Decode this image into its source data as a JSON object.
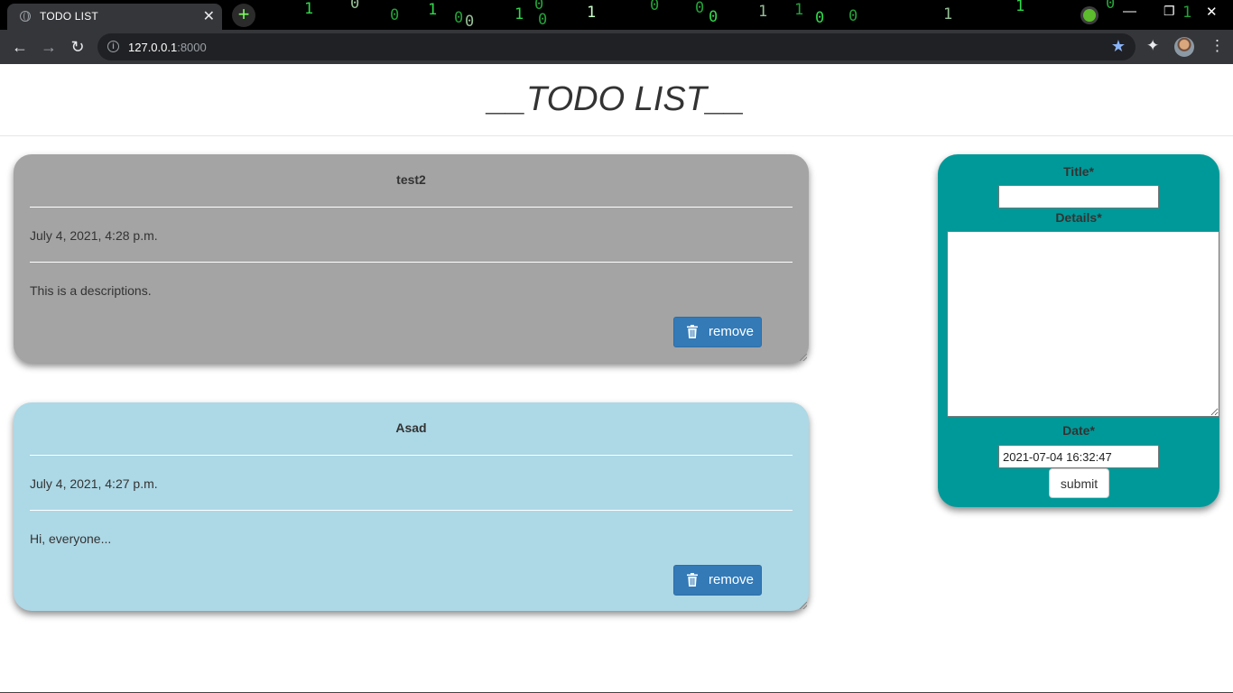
{
  "browser": {
    "tab_title": "TODO LIST",
    "tab_close": "✕",
    "new_tab": "+",
    "url_host": "127.0.0.1",
    "url_port": ":8000",
    "back": "←",
    "forward": "→",
    "reload": "↻",
    "star": "★",
    "extensions": "✦",
    "menu": "⋮",
    "minimize": "—",
    "maximize": "❐",
    "close": "✕",
    "matrix_glyphs": [
      "1",
      "0",
      "0",
      "1",
      "0",
      "0",
      "1",
      "0",
      "0",
      "1",
      "0",
      "0",
      "0",
      "1",
      "1",
      "0",
      "0",
      "1",
      "1",
      "0",
      "1"
    ]
  },
  "page": {
    "heading": "__TODO LIST__"
  },
  "todos": [
    {
      "title": "test2",
      "date": "July 4, 2021, 4:28 p.m.",
      "description": "This is a descriptions.",
      "remove_label": "remove",
      "bg_color": "#a4a4a4"
    },
    {
      "title": "Asad",
      "date": "July 4, 2021, 4:27 p.m.",
      "description": "Hi, everyone...",
      "remove_label": "remove",
      "bg_color": "#add8e6"
    }
  ],
  "form": {
    "title_label": "Title*",
    "title_value": "",
    "details_label": "Details*",
    "details_value": "",
    "date_label": "Date*",
    "date_value": "2021-07-04 16:32:47",
    "submit_label": "submit",
    "bg_color": "#009999"
  },
  "colors": {
    "accent_button": "#337ab7",
    "matrix_green": "#2fd94b"
  }
}
